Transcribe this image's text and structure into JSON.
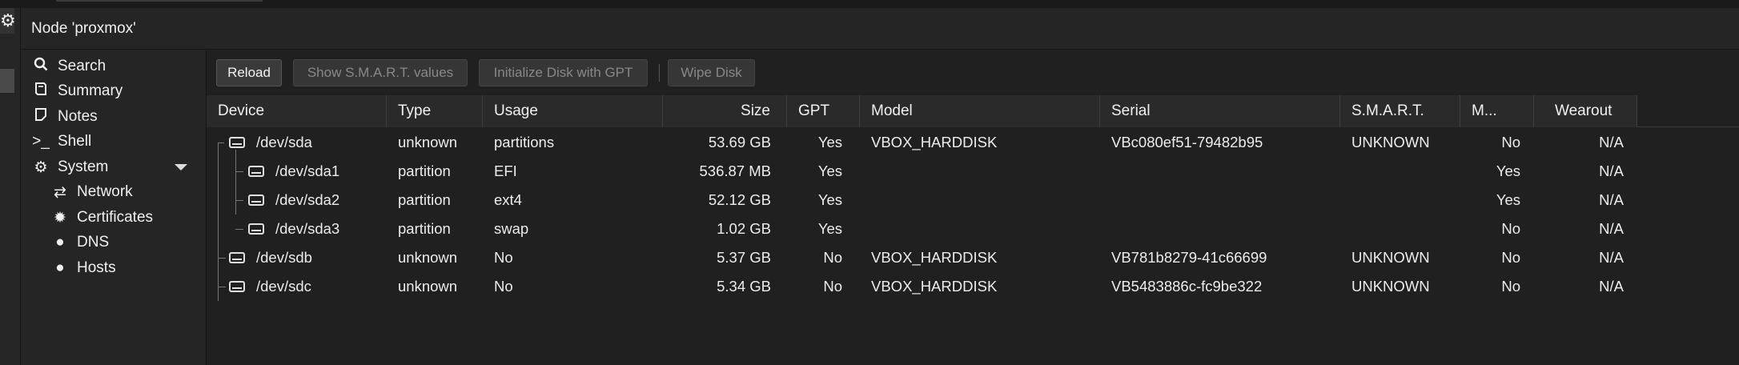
{
  "window": {
    "title": "Node 'proxmox'"
  },
  "gutter": {
    "gear_glyph": "⚙"
  },
  "nav": {
    "items": [
      {
        "label": "Search",
        "icon": "search-icon",
        "glyph": "🔍"
      },
      {
        "label": "Summary",
        "icon": "book-icon",
        "glyph": "📖"
      },
      {
        "label": "Notes",
        "icon": "notes-icon",
        "glyph": "▢"
      },
      {
        "label": "Shell",
        "icon": "terminal-icon",
        "glyph": ">_"
      },
      {
        "label": "System",
        "icon": "cogs-icon",
        "glyph": "⚙"
      },
      {
        "label": "Network",
        "icon": "exchange-icon",
        "glyph": "⇄"
      },
      {
        "label": "Certificates",
        "icon": "certificate-icon",
        "glyph": "✹"
      },
      {
        "label": "DNS",
        "icon": "globe-icon",
        "glyph": "●"
      },
      {
        "label": "Hosts",
        "icon": "globe-icon",
        "glyph": "●"
      }
    ]
  },
  "toolbar": {
    "reload": "Reload",
    "smart": "Show S.M.A.R.T. values",
    "init_gpt": "Initialize Disk with GPT",
    "wipe": "Wipe Disk"
  },
  "grid": {
    "columns": [
      "Device",
      "Type",
      "Usage",
      "Size",
      "GPT",
      "Model",
      "Serial",
      "S.M.A.R.T.",
      "M...",
      "Wearout"
    ],
    "rows": [
      {
        "device": "/dev/sda",
        "type": "unknown",
        "usage": "partitions",
        "size": "53.69 GB",
        "gpt": "Yes",
        "model": "VBOX_HARDDISK",
        "serial": "VBc080ef51-79482b95",
        "smart": "UNKNOWN",
        "m": "No",
        "wearout": "N/A"
      },
      {
        "device": "/dev/sda1",
        "type": "partition",
        "usage": "EFI",
        "size": "536.87 MB",
        "gpt": "Yes",
        "model": "",
        "serial": "",
        "smart": "",
        "m": "Yes",
        "wearout": "N/A"
      },
      {
        "device": "/dev/sda2",
        "type": "partition",
        "usage": "ext4",
        "size": "52.12 GB",
        "gpt": "Yes",
        "model": "",
        "serial": "",
        "smart": "",
        "m": "Yes",
        "wearout": "N/A"
      },
      {
        "device": "/dev/sda3",
        "type": "partition",
        "usage": "swap",
        "size": "1.02 GB",
        "gpt": "Yes",
        "model": "",
        "serial": "",
        "smart": "",
        "m": "No",
        "wearout": "N/A"
      },
      {
        "device": "/dev/sdb",
        "type": "unknown",
        "usage": "No",
        "size": "5.37 GB",
        "gpt": "No",
        "model": "VBOX_HARDDISK",
        "serial": "VB781b8279-41c66699",
        "smart": "UNKNOWN",
        "m": "No",
        "wearout": "N/A"
      },
      {
        "device": "/dev/sdc",
        "type": "unknown",
        "usage": "No",
        "size": "5.34 GB",
        "gpt": "No",
        "model": "VBOX_HARDDISK",
        "serial": "VB5483886c-fc9be322",
        "smart": "UNKNOWN",
        "m": "No",
        "wearout": "N/A"
      }
    ]
  }
}
